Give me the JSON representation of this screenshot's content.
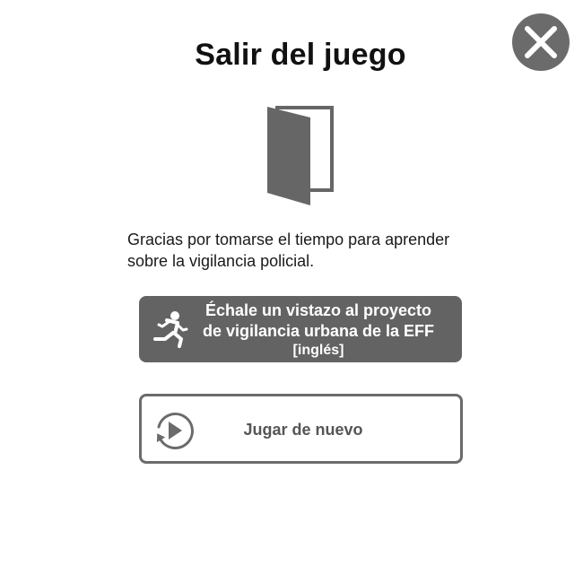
{
  "modal": {
    "title": "Salir del juego",
    "message": "Gracias por tomarse el tiempo para aprender sobre la vigilancia policial.",
    "close_icon": "close-icon",
    "door_icon": "door-open-icon"
  },
  "eff_button": {
    "line1": "Échale un vistazo al proyecto",
    "line2": "de vigilancia urbana de la EFF",
    "line3": "[inglés]",
    "icon": "running-person-icon"
  },
  "replay_button": {
    "label": "Jugar de nuevo",
    "icon": "replay-icon"
  },
  "colors": {
    "accent_gray": "#6b6b6b",
    "button_fill": "#636363",
    "text": "#111111"
  }
}
